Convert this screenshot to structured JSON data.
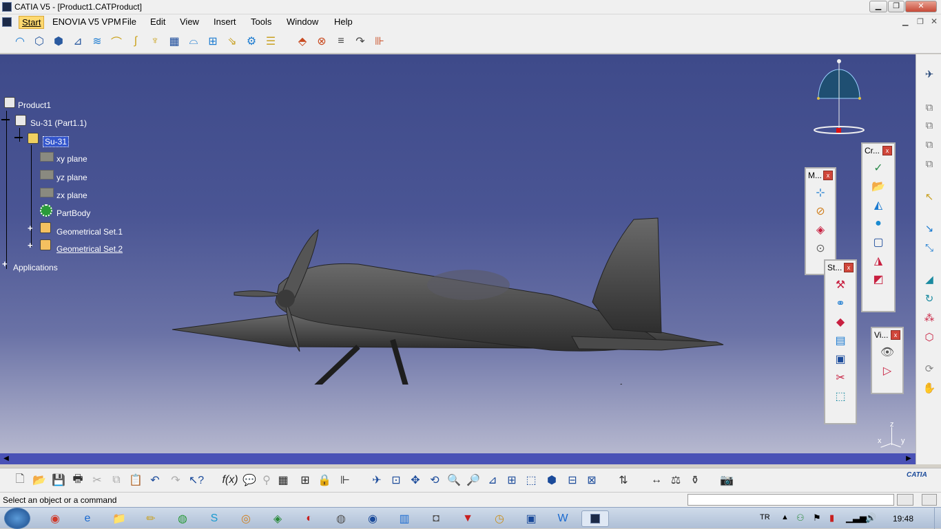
{
  "window": {
    "title": "CATIA V5 - [Product1.CATProduct]",
    "minimize_icon": "minimize-icon",
    "maximize_icon": "maximize-icon",
    "close_icon": "close-icon"
  },
  "menubar": {
    "items": [
      "Start",
      "ENOVIA V5 VPM",
      "File",
      "Edit",
      "View",
      "Insert",
      "Tools",
      "Window",
      "Help"
    ]
  },
  "spec_tree": {
    "root": "Product1",
    "child": "Su-31 (Part1.1)",
    "part": "Su-31",
    "items": [
      "xy plane",
      "yz plane",
      "zx plane",
      "PartBody",
      "Geometrical Set.1",
      "Geometrical Set.2"
    ],
    "applications": "Applications"
  },
  "floating_toolbars": {
    "m": "M...",
    "cr": "Cr...",
    "st": "St...",
    "vi": "Vi..."
  },
  "axis": {
    "x": "x",
    "y": "y",
    "z": "z"
  },
  "status": {
    "prompt": "Select an object or a command"
  },
  "taskbar": {
    "language": "TR",
    "clock": "19:48"
  },
  "brand": {
    "logo_text": "CATIA"
  },
  "colors": {
    "viewport_top": "#3e4a8a",
    "viewport_bottom": "#b6b8cf",
    "selection": "#3355cc",
    "scrollbar": "#4a52b6"
  }
}
